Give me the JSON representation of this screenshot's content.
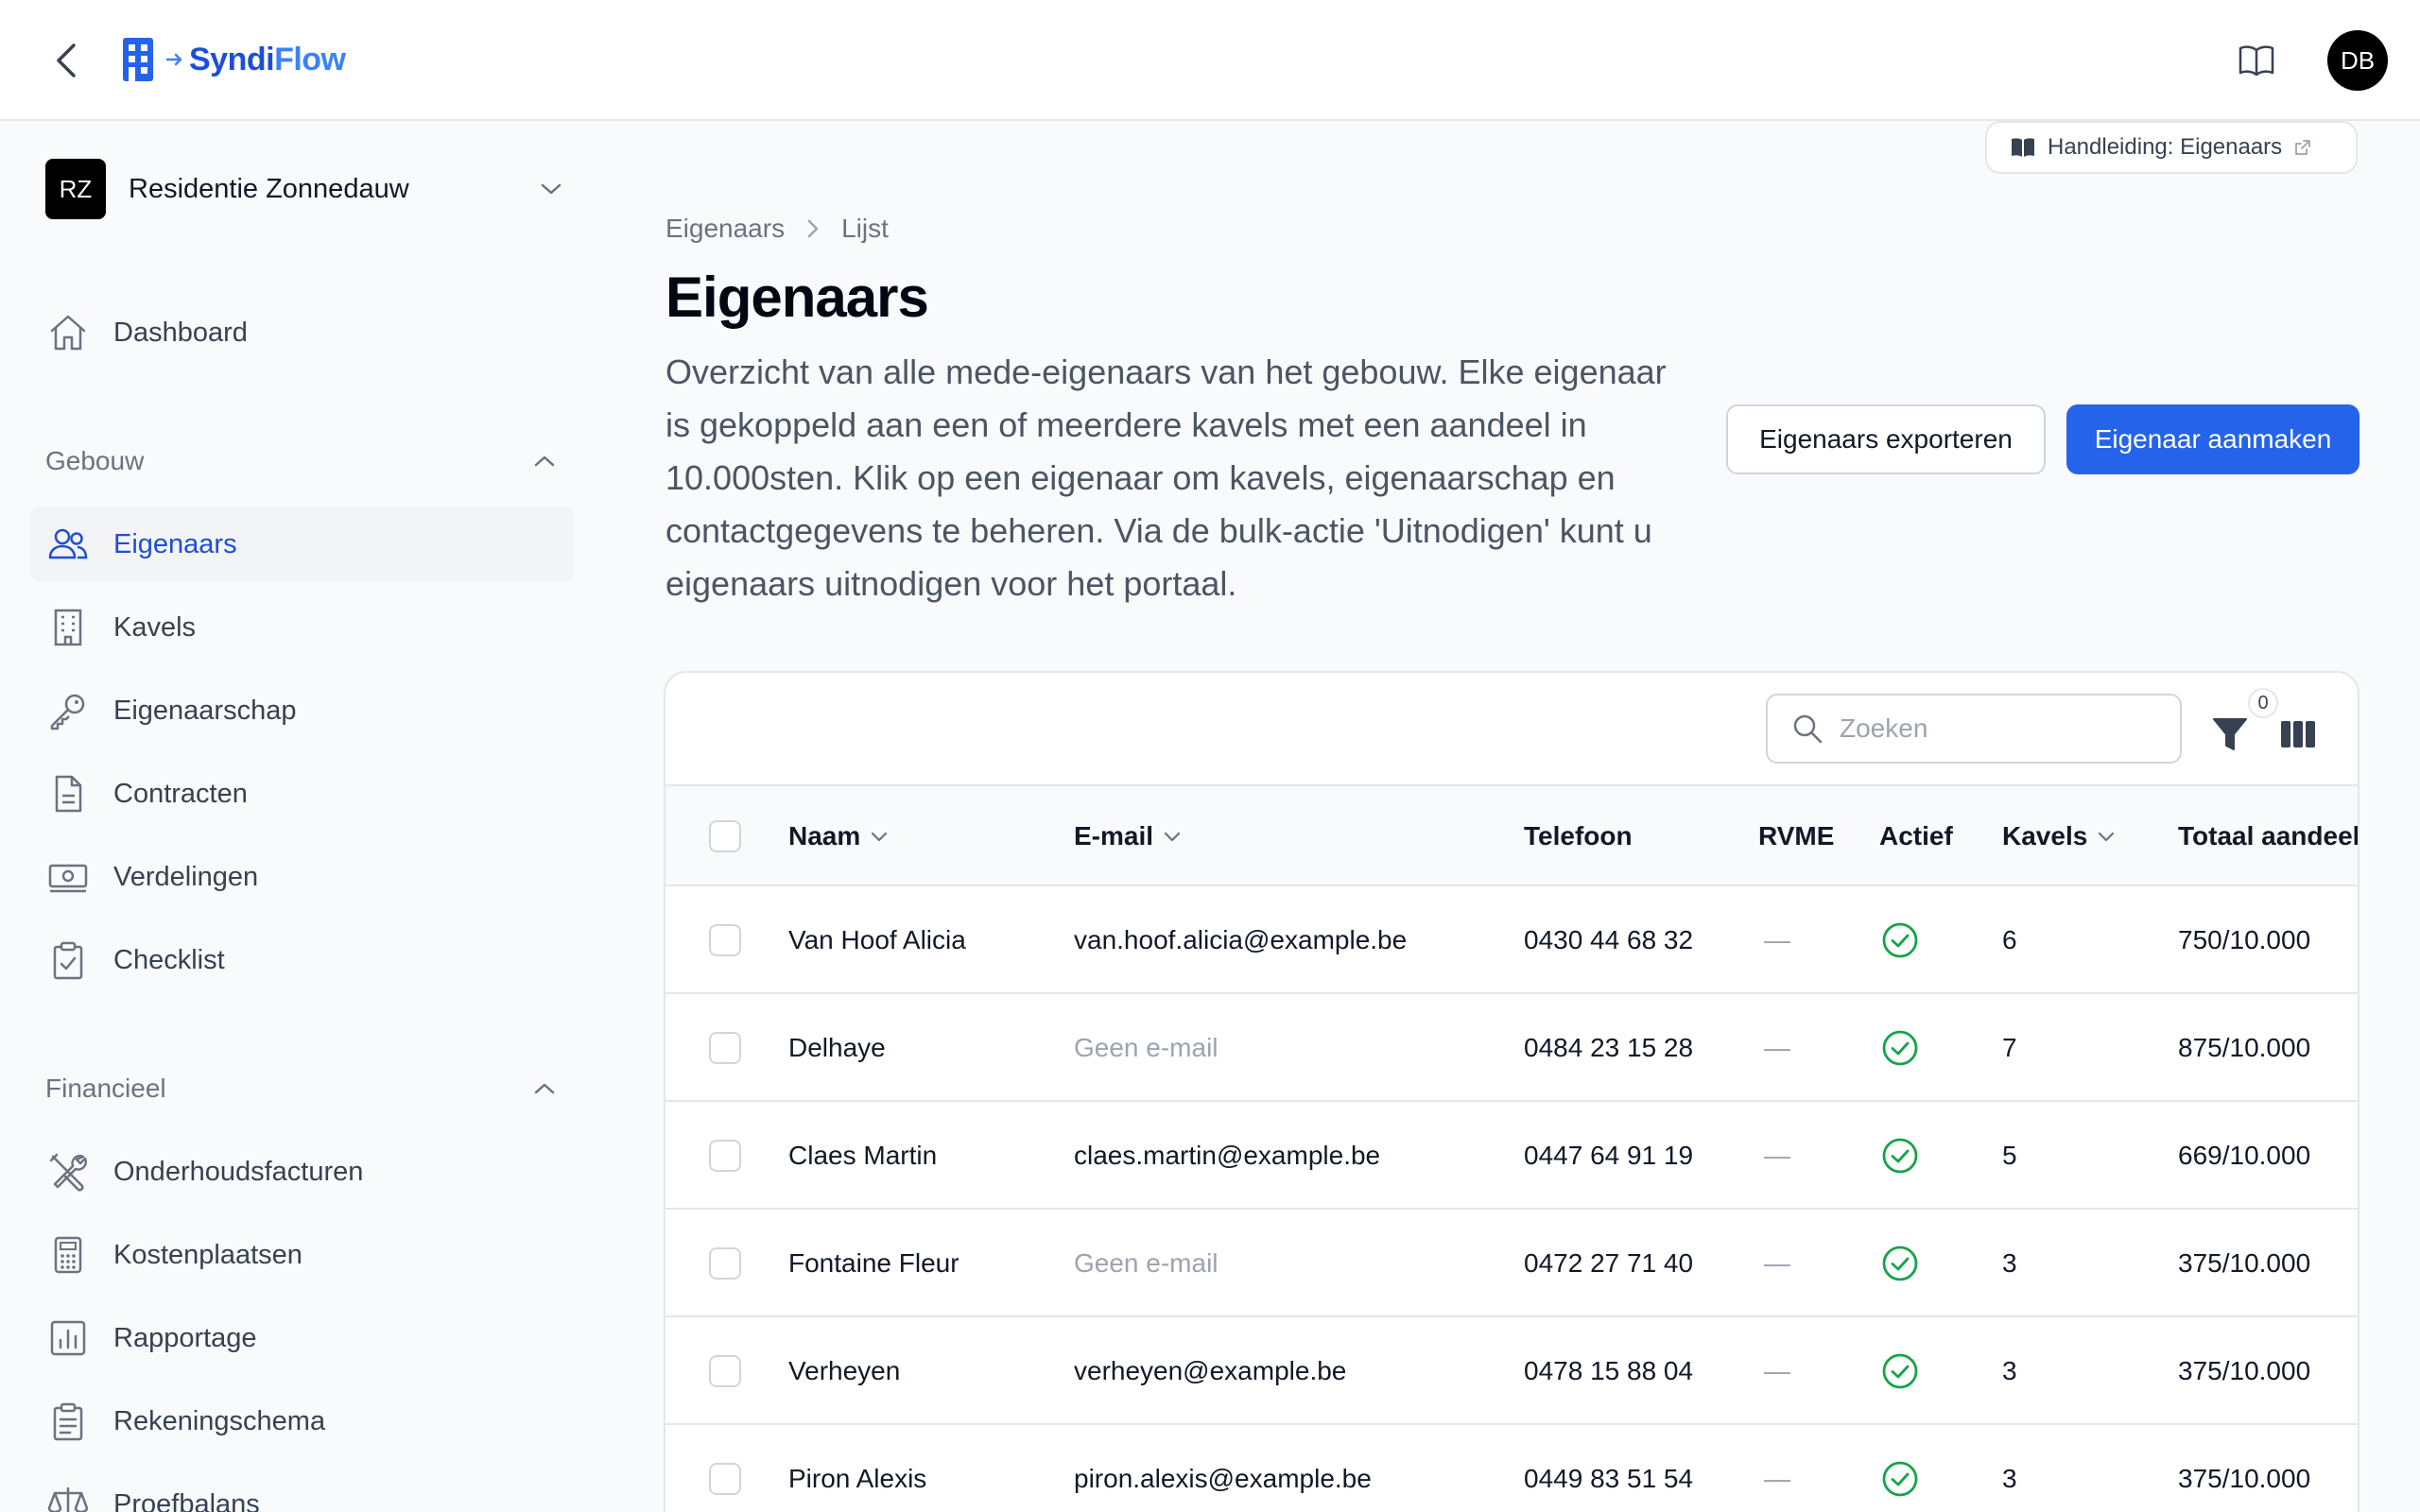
{
  "header": {
    "logo_text_1": "Syndi",
    "logo_text_2": "Flow",
    "avatar_initials": "DB"
  },
  "sidebar": {
    "tenant": {
      "initials": "RZ",
      "name": "Residentie Zonnedauw"
    },
    "dashboard": "Dashboard",
    "sections": [
      {
        "label": "Gebouw",
        "items": [
          "Eigenaars",
          "Kavels",
          "Eigenaarschap",
          "Contracten",
          "Verdelingen",
          "Checklist"
        ]
      },
      {
        "label": "Financieel",
        "items": [
          "Onderhoudsfacturen",
          "Kostenplaatsen",
          "Rapportage",
          "Rekeningschema",
          "Proefbalans"
        ]
      }
    ]
  },
  "manual": {
    "label": "Handleiding: Eigenaars"
  },
  "breadcrumb": {
    "parent": "Eigenaars",
    "current": "Lijst"
  },
  "page": {
    "title": "Eigenaars",
    "description": "Overzicht van alle mede-eigenaars van het gebouw. Elke eigenaar is gekoppeld aan een of meerdere kavels met een aandeel in 10.000sten. Klik op een eigenaar om kavels, eigenaarschap en contactgegevens te beheren. Via de bulk-actie 'Uitnodigen' kunt u eigenaars uitnodigen voor het portaal."
  },
  "actions": {
    "export": "Eigenaars exporteren",
    "create": "Eigenaar aanmaken"
  },
  "table": {
    "search_placeholder": "Zoeken",
    "filter_count": "0",
    "columns": {
      "naam": "Naam",
      "email": "E-mail",
      "telefoon": "Telefoon",
      "rvme": "RVME",
      "actief": "Actief",
      "kavels": "Kavels",
      "aandeel": "Totaal aandeel"
    },
    "rows": [
      {
        "naam": "Van Hoof Alicia",
        "email": "van.hoof.alicia@example.be",
        "telefoon": "0430 44 68 32",
        "rvme": "—",
        "kavels": "6",
        "aandeel": "750/10.000"
      },
      {
        "naam": "Delhaye",
        "email": "Geen e-mail",
        "telefoon": "0484 23 15 28",
        "rvme": "—",
        "kavels": "7",
        "aandeel": "875/10.000"
      },
      {
        "naam": "Claes Martin",
        "email": "claes.martin@example.be",
        "telefoon": "0447 64 91 19",
        "rvme": "—",
        "kavels": "5",
        "aandeel": "669/10.000"
      },
      {
        "naam": "Fontaine Fleur",
        "email": "Geen e-mail",
        "telefoon": "0472 27 71 40",
        "rvme": "—",
        "kavels": "3",
        "aandeel": "375/10.000"
      },
      {
        "naam": "Verheyen",
        "email": "verheyen@example.be",
        "telefoon": "0478 15 88 04",
        "rvme": "—",
        "kavels": "3",
        "aandeel": "375/10.000"
      },
      {
        "naam": "Piron Alexis",
        "email": "piron.alexis@example.be",
        "telefoon": "0449 83 51 54",
        "rvme": "—",
        "kavels": "3",
        "aandeel": "375/10.000"
      }
    ]
  }
}
